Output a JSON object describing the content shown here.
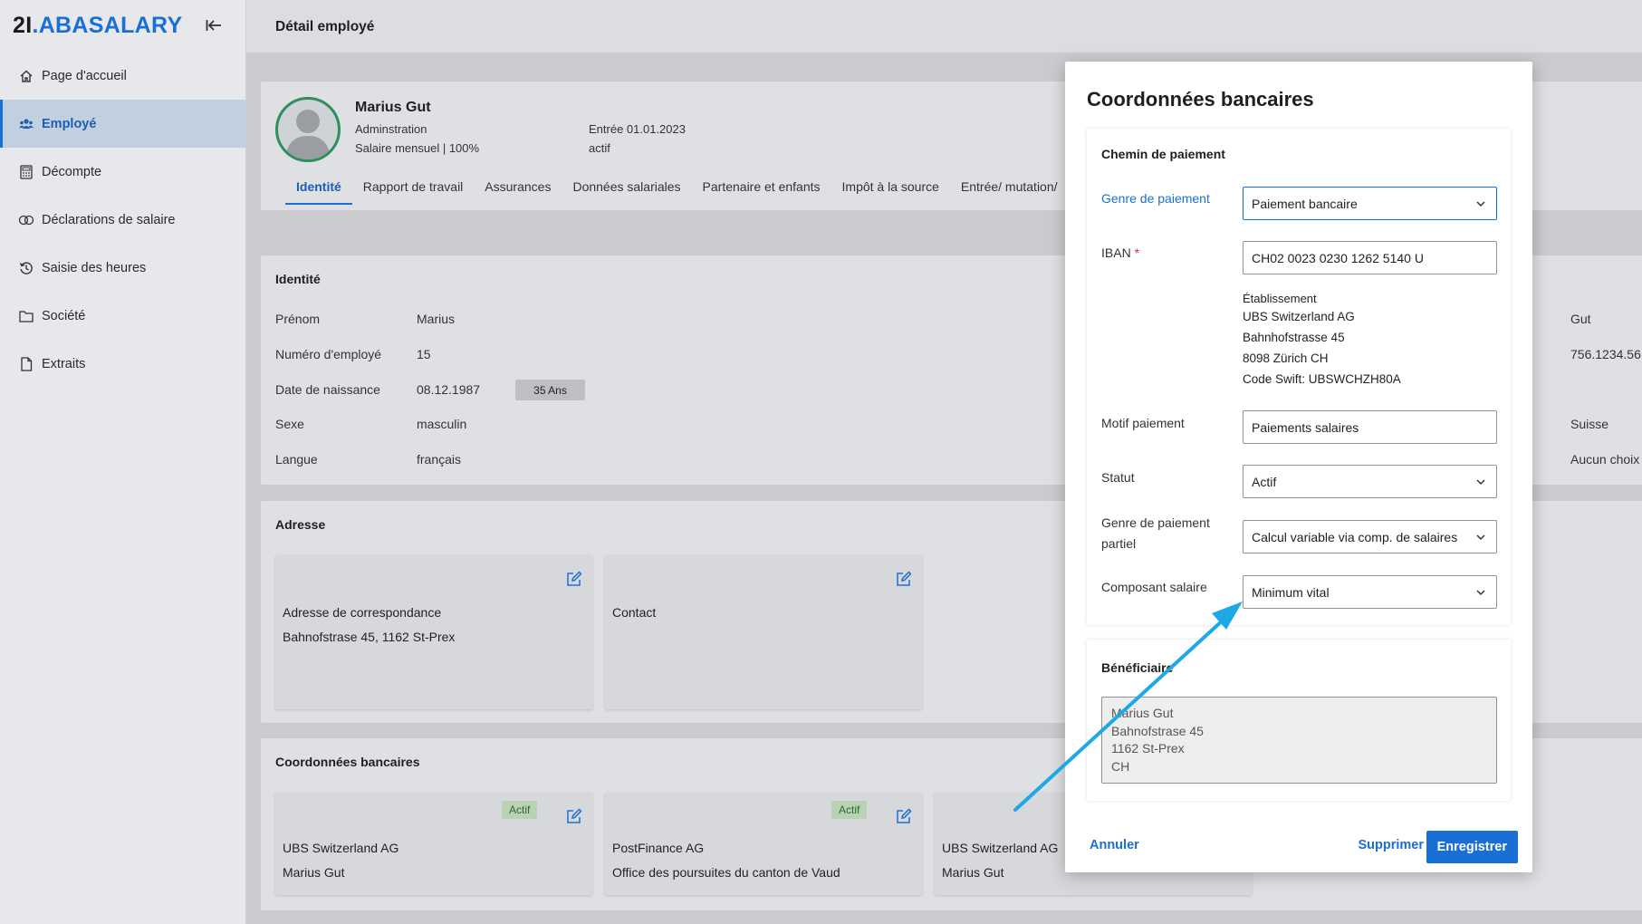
{
  "logo": {
    "num": "2I",
    "dot": ".",
    "brand": "ABASALARY"
  },
  "sidebar": {
    "items": [
      {
        "label": "Page d'accueil",
        "icon": "home-icon"
      },
      {
        "label": "Employé",
        "icon": "users-icon"
      },
      {
        "label": "Décompte",
        "icon": "calculator-icon"
      },
      {
        "label": "Déclarations de salaire",
        "icon": "declarations-icon"
      },
      {
        "label": "Saisie des heures",
        "icon": "history-icon"
      },
      {
        "label": "Société",
        "icon": "folder-icon"
      },
      {
        "label": "Extraits",
        "icon": "file-icon"
      }
    ]
  },
  "header": {
    "title": "Détail employé"
  },
  "employee": {
    "name": "Marius Gut",
    "department": "Adminstration",
    "salary": "Salaire mensuel | 100%",
    "entry": "Entrée 01.01.2023",
    "status": "actif"
  },
  "tabs": [
    "Identité",
    "Rapport de travail",
    "Assurances",
    "Données salariales",
    "Partenaire et enfants",
    "Impôt à la source",
    "Entrée/ mutation/"
  ],
  "identity": {
    "title": "Identité",
    "fields": [
      {
        "label": "Prénom",
        "value": "Marius"
      },
      {
        "label": "Numéro d'employé",
        "value": "15"
      },
      {
        "label": "Date de naissance",
        "value": "08.12.1987"
      },
      {
        "label": "Sexe",
        "value": "masculin"
      },
      {
        "label": "Langue",
        "value": "français"
      }
    ],
    "age_badge": "35 Ans",
    "right_values": [
      "Gut",
      "756.1234.56",
      "Suisse",
      "Aucun choix"
    ]
  },
  "address": {
    "title": "Adresse",
    "cards": [
      {
        "line1": "Adresse de correspondance",
        "line2": "Bahnofstrase 45, 1162 St-Prex"
      },
      {
        "line1": "Contact",
        "line2": ""
      }
    ]
  },
  "bank": {
    "title": "Coordonnées bancaires",
    "cards": [
      {
        "badge": "Actif",
        "line1": "UBS Switzerland AG",
        "line2": "Marius Gut"
      },
      {
        "badge": "Actif",
        "line1": "PostFinance AG",
        "line2": "Office des poursuites du canton de Vaud"
      },
      {
        "badge": "",
        "line1": "UBS Switzerland AG",
        "line2": "Marius Gut"
      }
    ]
  },
  "modal": {
    "title": "Coordonnées bancaires",
    "payment_section": {
      "title": "Chemin de paiement",
      "payment_type_label": "Genre de paiement",
      "payment_type_value": "Paiement bancaire",
      "iban_label": "IBAN",
      "iban_required": "*",
      "iban_value": "CH02 0023 0230 1262 5140 U",
      "institution_label": "Établissement",
      "institution_name": "UBS Switzerland AG",
      "institution_street": "Bahnhofstrasse 45",
      "institution_city": "8098 Zürich CH",
      "institution_swift": "Code Swift: UBSWCHZH80A",
      "reason_label": "Motif paiement",
      "reason_value": "Paiements salaires",
      "status_label": "Statut",
      "status_value": "Actif",
      "partial_label_1": "Genre de paiement",
      "partial_label_2": "partiel",
      "partial_value": "Calcul variable via comp. de salaires",
      "component_label": "Composant salaire",
      "component_value": "Minimum vital"
    },
    "beneficiary_section": {
      "title": "Bénéficiaire",
      "lines": [
        "Marius Gut",
        "Bahnofstrase 45",
        "1162 St-Prex",
        "CH"
      ]
    },
    "footer": {
      "cancel": "Annuler",
      "delete": "Supprimer",
      "save": "Enregistrer"
    }
  },
  "colors": {
    "accent": "#1a6fd6",
    "annotation_arrow": "#1ea8e6",
    "active_badge": "#b9d2b3",
    "avatar_ring": "#2f8f5c"
  }
}
